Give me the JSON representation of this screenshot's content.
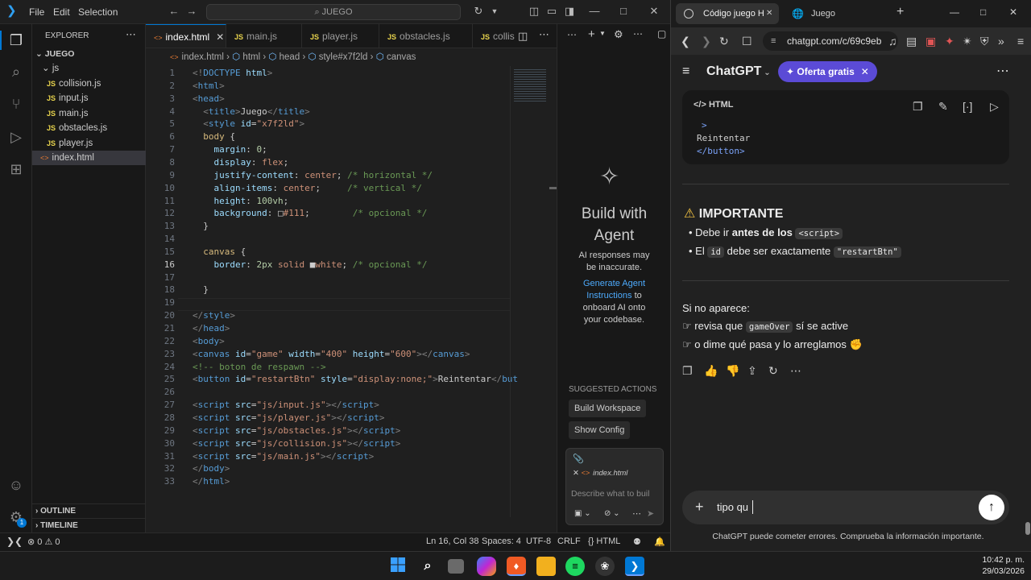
{
  "vscode": {
    "menu": [
      "File",
      "Edit",
      "Selection"
    ],
    "search": "JUEGO",
    "explorer": {
      "title": "EXPLORER",
      "root": "JUEGO",
      "folder": "js",
      "files": [
        "collision.js",
        "input.js",
        "main.js",
        "obstacles.js",
        "player.js"
      ],
      "root_file": "index.html",
      "outline": "OUTLINE",
      "timeline": "TIMELINE"
    },
    "tabs": [
      "index.html",
      "main.js",
      "player.js",
      "obstacles.js",
      "collis"
    ],
    "breadcrumb": [
      "index.html",
      "html",
      "head",
      "style#x7f2ld",
      "canvas"
    ],
    "current_line": 16,
    "code": [
      [
        [
          "t-gray",
          "<!"
        ],
        [
          "t-tag",
          "DOCTYPE"
        ],
        [
          "t-attr",
          " html"
        ],
        [
          "t-gray",
          ">"
        ]
      ],
      [
        [
          "t-gray",
          "<"
        ],
        [
          "t-tag",
          "html"
        ],
        [
          "t-gray",
          ">"
        ]
      ],
      [
        [
          "t-gray",
          "<"
        ],
        [
          "t-tag",
          "head"
        ],
        [
          "t-gray",
          ">"
        ]
      ],
      [
        [
          "t-plain",
          "  "
        ],
        [
          "t-gray",
          "<"
        ],
        [
          "t-tag",
          "title"
        ],
        [
          "t-gray",
          ">"
        ],
        [
          "t-plain",
          "Juego"
        ],
        [
          "t-gray",
          "</"
        ],
        [
          "t-tag",
          "title"
        ],
        [
          "t-gray",
          ">"
        ]
      ],
      [
        [
          "t-plain",
          "  "
        ],
        [
          "t-gray",
          "<"
        ],
        [
          "t-tag",
          "style"
        ],
        [
          "t-attr",
          " id"
        ],
        [
          "t-plain",
          "="
        ],
        [
          "t-str",
          "\"x7f2ld\""
        ],
        [
          "t-gray",
          ">"
        ]
      ],
      [
        [
          "t-plain",
          "  "
        ],
        [
          "t-sel",
          "body"
        ],
        [
          "t-plain",
          " {"
        ]
      ],
      [
        [
          "t-plain",
          "    "
        ],
        [
          "t-attr",
          "margin"
        ],
        [
          "t-plain",
          ": "
        ],
        [
          "t-num",
          "0"
        ],
        [
          "t-plain",
          ";"
        ]
      ],
      [
        [
          "t-plain",
          "    "
        ],
        [
          "t-attr",
          "display"
        ],
        [
          "t-plain",
          ": "
        ],
        [
          "t-val",
          "flex"
        ],
        [
          "t-plain",
          ";"
        ]
      ],
      [
        [
          "t-plain",
          "    "
        ],
        [
          "t-attr",
          "justify-content"
        ],
        [
          "t-plain",
          ": "
        ],
        [
          "t-val",
          "center"
        ],
        [
          "t-plain",
          "; "
        ],
        [
          "t-com",
          "/* horizontal */"
        ]
      ],
      [
        [
          "t-plain",
          "    "
        ],
        [
          "t-attr",
          "align-items"
        ],
        [
          "t-plain",
          ": "
        ],
        [
          "t-val",
          "center"
        ],
        [
          "t-plain",
          ";     "
        ],
        [
          "t-com",
          "/* vertical */"
        ]
      ],
      [
        [
          "t-plain",
          "    "
        ],
        [
          "t-attr",
          "height"
        ],
        [
          "t-plain",
          ": "
        ],
        [
          "t-num",
          "100vh"
        ],
        [
          "t-plain",
          ";"
        ]
      ],
      [
        [
          "t-plain",
          "    "
        ],
        [
          "t-attr",
          "background"
        ],
        [
          "t-plain",
          ": □"
        ],
        [
          "t-val",
          "#111"
        ],
        [
          "t-plain",
          ";        "
        ],
        [
          "t-com",
          "/* opcional */"
        ]
      ],
      [
        [
          "t-plain",
          "  }"
        ]
      ],
      [
        [
          "t-plain",
          ""
        ]
      ],
      [
        [
          "t-plain",
          "  "
        ],
        [
          "t-sel",
          "canvas"
        ],
        [
          "t-plain",
          " {"
        ]
      ],
      [
        [
          "t-plain",
          "    "
        ],
        [
          "t-attr",
          "border"
        ],
        [
          "t-plain",
          ": "
        ],
        [
          "t-num",
          "2px"
        ],
        [
          "t-val",
          " solid"
        ],
        [
          "t-plain",
          " ■"
        ],
        [
          "t-val",
          "white"
        ],
        [
          "t-plain",
          "; "
        ],
        [
          "t-com",
          "/* opcional */"
        ]
      ],
      [
        [
          "t-plain",
          ""
        ]
      ],
      [
        [
          "t-plain",
          "  }"
        ]
      ],
      [
        [
          "t-plain",
          ""
        ]
      ],
      [
        [
          "t-gray",
          "</"
        ],
        [
          "t-tag",
          "style"
        ],
        [
          "t-gray",
          ">"
        ]
      ],
      [
        [
          "t-gray",
          "</"
        ],
        [
          "t-tag",
          "head"
        ],
        [
          "t-gray",
          ">"
        ]
      ],
      [
        [
          "t-gray",
          "<"
        ],
        [
          "t-tag",
          "body"
        ],
        [
          "t-gray",
          ">"
        ]
      ],
      [
        [
          "t-gray",
          "<"
        ],
        [
          "t-tag",
          "canvas"
        ],
        [
          "t-attr",
          " id"
        ],
        [
          "t-plain",
          "="
        ],
        [
          "t-str",
          "\"game\""
        ],
        [
          "t-attr",
          " width"
        ],
        [
          "t-plain",
          "="
        ],
        [
          "t-str",
          "\"400\""
        ],
        [
          "t-attr",
          " height"
        ],
        [
          "t-plain",
          "="
        ],
        [
          "t-str",
          "\"600\""
        ],
        [
          "t-gray",
          "></"
        ],
        [
          "t-tag",
          "canvas"
        ],
        [
          "t-gray",
          ">"
        ]
      ],
      [
        [
          "t-com",
          "<!-- boton de respawn -->"
        ]
      ],
      [
        [
          "t-gray",
          "<"
        ],
        [
          "t-tag",
          "button"
        ],
        [
          "t-attr",
          " id"
        ],
        [
          "t-plain",
          "="
        ],
        [
          "t-str",
          "\"restartBtn\""
        ],
        [
          "t-attr",
          " style"
        ],
        [
          "t-plain",
          "="
        ],
        [
          "t-str",
          "\"display:none;\""
        ],
        [
          "t-gray",
          ">"
        ],
        [
          "t-plain",
          "Reintentar"
        ],
        [
          "t-gray",
          "</"
        ],
        [
          "t-tag",
          "but"
        ]
      ],
      [
        [
          "t-plain",
          ""
        ]
      ],
      [
        [
          "t-gray",
          "<"
        ],
        [
          "t-tag",
          "script"
        ],
        [
          "t-attr",
          " src"
        ],
        [
          "t-plain",
          "="
        ],
        [
          "t-str",
          "\"js/input.js\""
        ],
        [
          "t-gray",
          "></"
        ],
        [
          "t-tag",
          "script"
        ],
        [
          "t-gray",
          ">"
        ]
      ],
      [
        [
          "t-gray",
          "<"
        ],
        [
          "t-tag",
          "script"
        ],
        [
          "t-attr",
          " src"
        ],
        [
          "t-plain",
          "="
        ],
        [
          "t-str",
          "\"js/player.js\""
        ],
        [
          "t-gray",
          "></"
        ],
        [
          "t-tag",
          "script"
        ],
        [
          "t-gray",
          ">"
        ]
      ],
      [
        [
          "t-gray",
          "<"
        ],
        [
          "t-tag",
          "script"
        ],
        [
          "t-attr",
          " src"
        ],
        [
          "t-plain",
          "="
        ],
        [
          "t-str",
          "\"js/obstacles.js\""
        ],
        [
          "t-gray",
          "></"
        ],
        [
          "t-tag",
          "script"
        ],
        [
          "t-gray",
          ">"
        ]
      ],
      [
        [
          "t-gray",
          "<"
        ],
        [
          "t-tag",
          "script"
        ],
        [
          "t-attr",
          " src"
        ],
        [
          "t-plain",
          "="
        ],
        [
          "t-str",
          "\"js/collision.js\""
        ],
        [
          "t-gray",
          "></"
        ],
        [
          "t-tag",
          "script"
        ],
        [
          "t-gray",
          ">"
        ]
      ],
      [
        [
          "t-gray",
          "<"
        ],
        [
          "t-tag",
          "script"
        ],
        [
          "t-attr",
          " src"
        ],
        [
          "t-plain",
          "="
        ],
        [
          "t-str",
          "\"js/main.js\""
        ],
        [
          "t-gray",
          "></"
        ],
        [
          "t-tag",
          "script"
        ],
        [
          "t-gray",
          ">"
        ]
      ],
      [
        [
          "t-gray",
          "</"
        ],
        [
          "t-tag",
          "body"
        ],
        [
          "t-gray",
          ">"
        ]
      ],
      [
        [
          "t-gray",
          "</"
        ],
        [
          "t-tag",
          "html"
        ],
        [
          "t-gray",
          ">"
        ]
      ]
    ],
    "agent": {
      "title": "Build with Agent",
      "disclaimer": "AI responses may be inaccurate.",
      "link": "Generate Agent Instructions",
      "link_suffix": "to onboard AI onto your codebase.",
      "suggested_title": "SUGGESTED ACTIONS",
      "actions": [
        "Build Workspace",
        "Show Config"
      ],
      "attachment": "index.html",
      "placeholder": "Describe what to buil"
    },
    "status": {
      "errors": "0",
      "warnings": "0",
      "position": "Ln 16, Col 38",
      "spaces": "Spaces: 4",
      "encoding": "UTF-8",
      "eol": "CRLF",
      "language": "HTML",
      "badge": "1"
    }
  },
  "browser": {
    "tabs": [
      "Código juego H",
      "Juego"
    ],
    "url": "chatgpt.com/c/69c9eb",
    "header": {
      "title": "ChatGPT",
      "offer": "Oferta gratis"
    },
    "code_block": {
      "lang": "HTML",
      "lines": [
        ">",
        "Reintentar",
        "</button>"
      ]
    },
    "important": {
      "heading": "IMPORTANTE",
      "bullet1_pre": "Debe ir",
      "bullet1_bold": "antes de los",
      "bullet1_code": "<script>",
      "bullet2_pre": "El",
      "bullet2_code1": "id",
      "bullet2_mid": "debe ser exactamente",
      "bullet2_code2": "\"restartBtn\""
    },
    "followup": {
      "intro": "Si no aparece:",
      "line1_pre": "revisa que",
      "line1_code": "gameOver",
      "line1_post": "sí se active",
      "line2": "o dime qué pasa y lo arreglamos"
    },
    "composer": {
      "value": "tipo qu",
      "disclaimer": "ChatGPT puede cometer errores. Comprueba la información importante."
    }
  },
  "taskbar": {
    "time": "10:42 p. m.",
    "date": "29/03/2026"
  },
  "colors": {
    "vs_accent": "#0078d4",
    "vs_bg": "#1f1f1f",
    "gpt_bg": "#212121",
    "offer_bg": "#5b4bd6",
    "js_yellow": "#e8d44d",
    "html_orange": "#e37933"
  }
}
